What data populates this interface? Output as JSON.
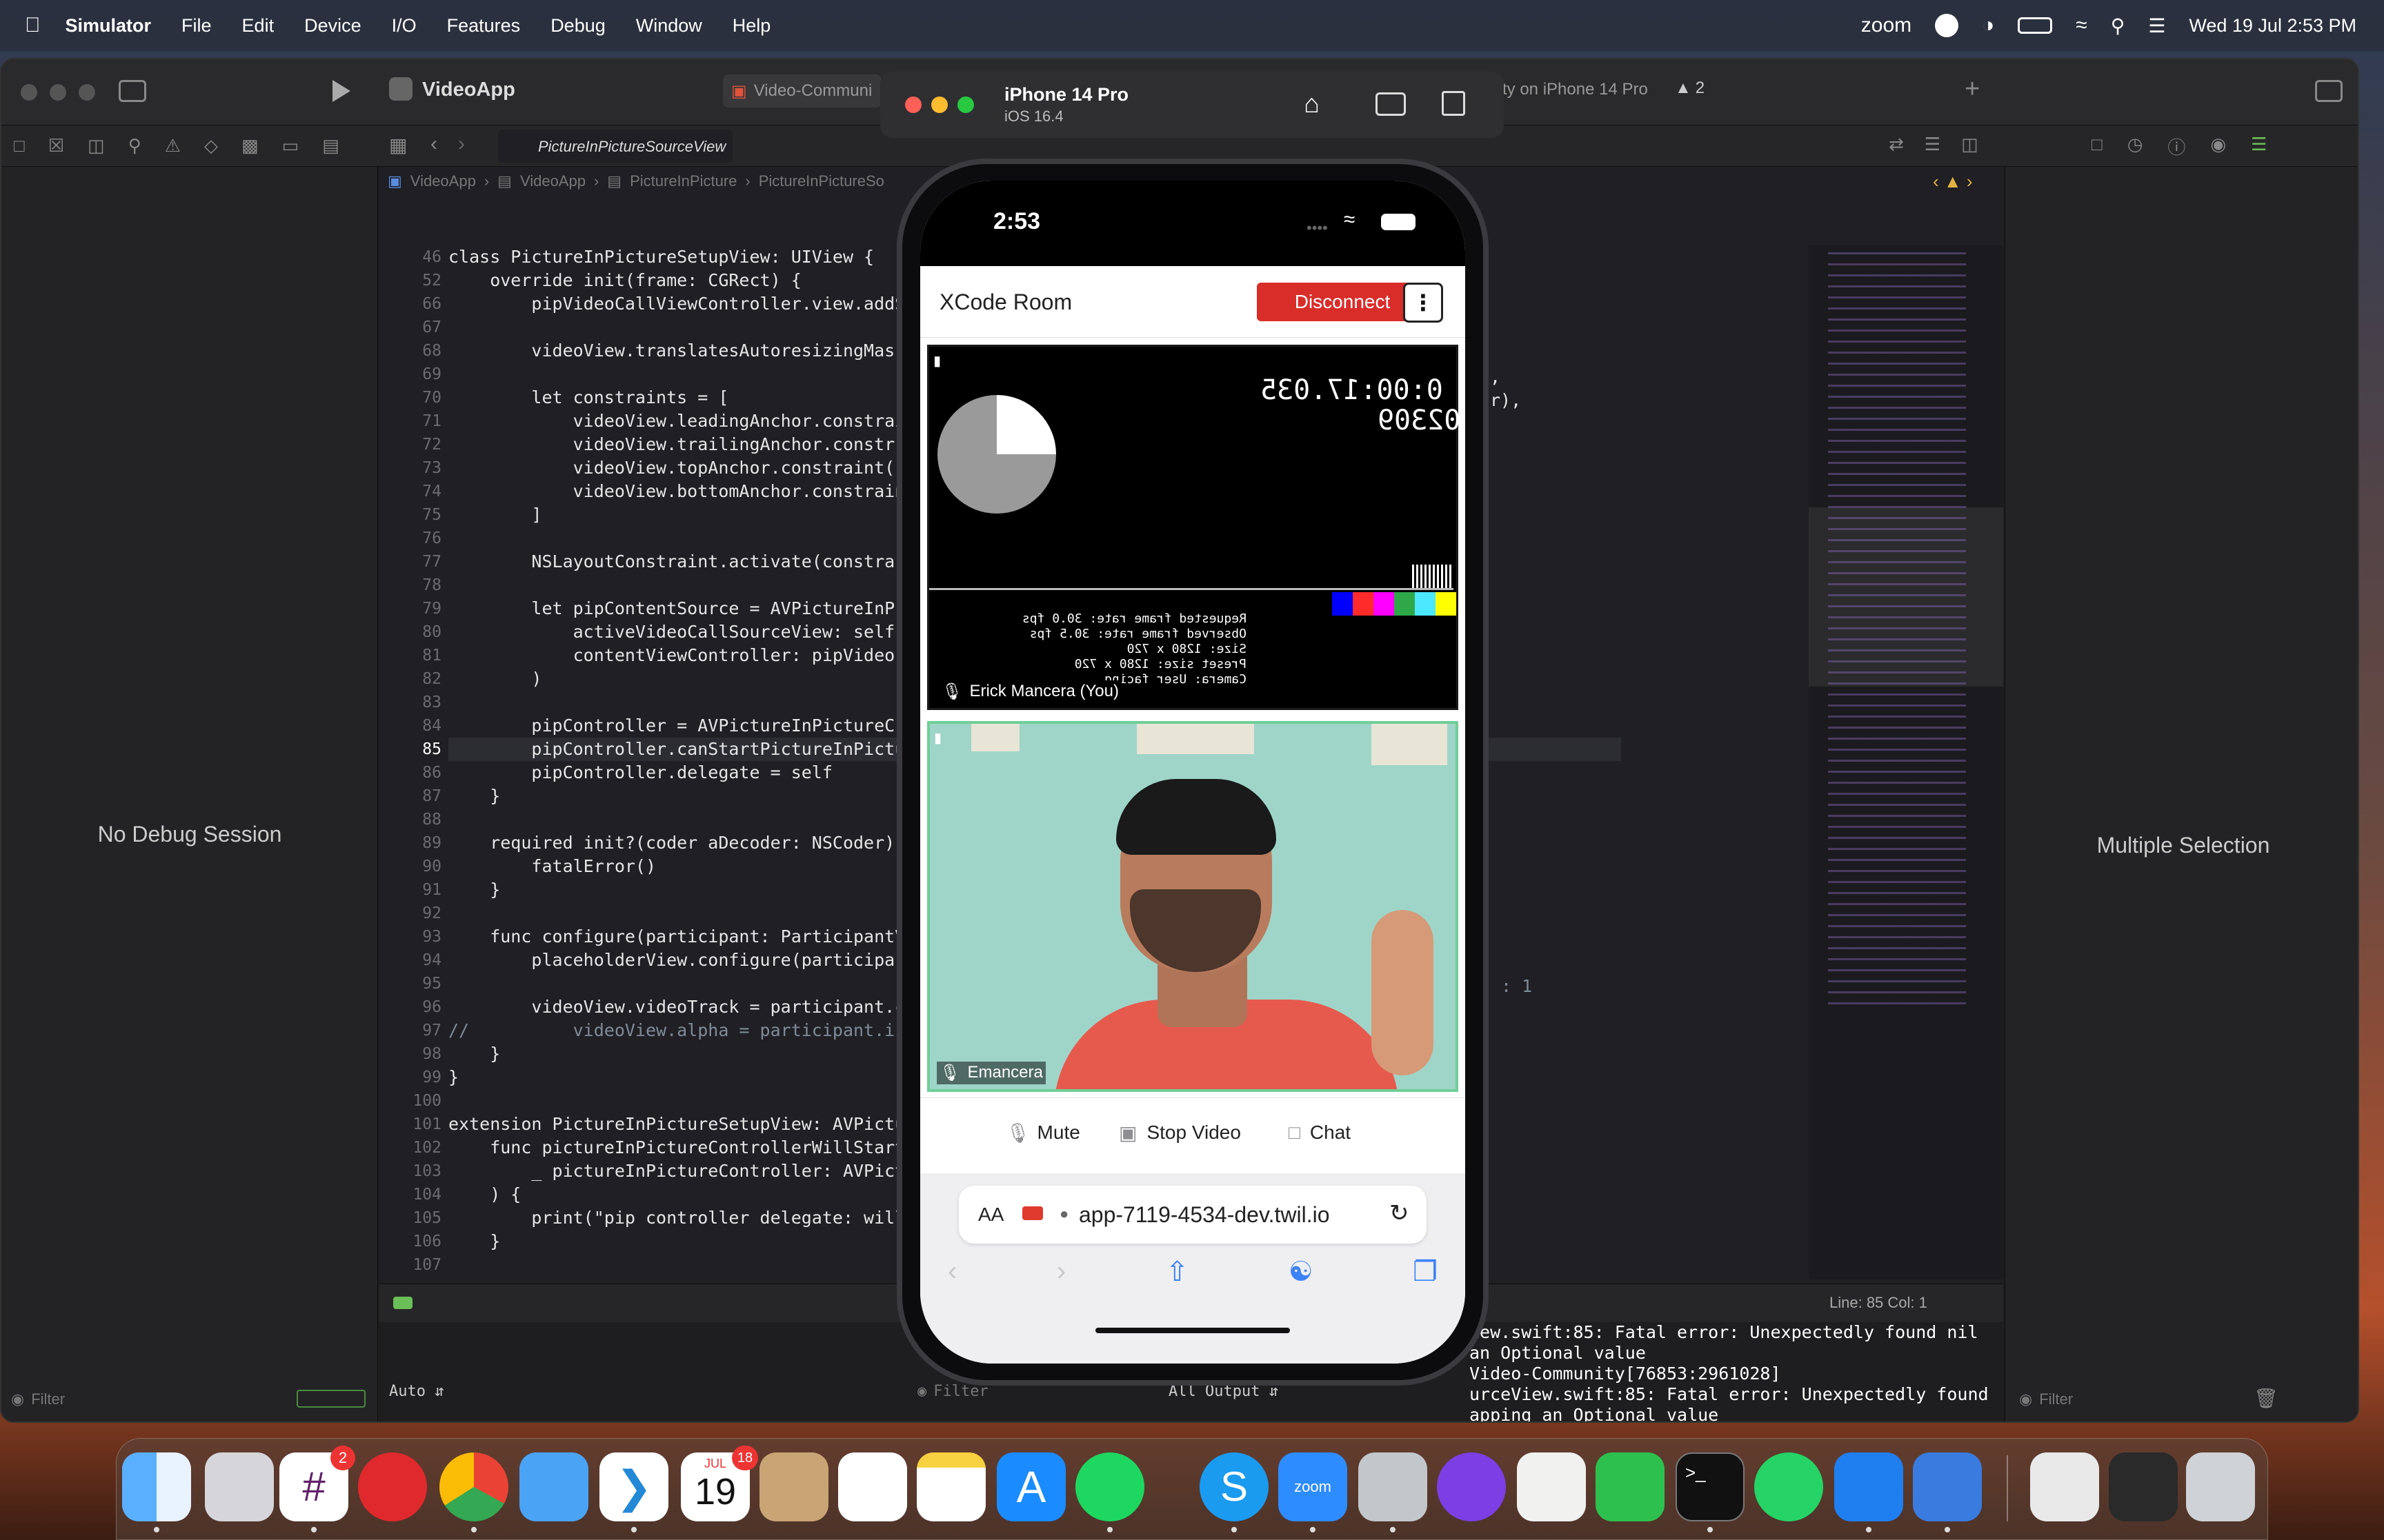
{
  "menubar": {
    "app_name": "Simulator",
    "menus": [
      "File",
      "Edit",
      "Device",
      "I/O",
      "Features",
      "Debug",
      "Window",
      "Help"
    ],
    "zoom_label": "zoom",
    "datetime": "Wed 19 Jul  2:53 PM"
  },
  "xcode": {
    "project": "VideoApp",
    "tab_active": "PictureInPictureSourceView",
    "tab_other": "Video-Communi",
    "scheme_destination": "ty on iPhone 14 Pro",
    "warning_count": "2",
    "breadcrumb": [
      "VideoApp",
      "VideoApp",
      "PictureInPicture",
      "PictureInPictureSo"
    ],
    "left_pane_status": "No Debug Session",
    "right_pane_status": "Multiple Selection",
    "cursor_position": "Line: 85  Col: 1",
    "filter_placeholder": "Filter",
    "debug_mode": "Auto",
    "output_select": "All Output",
    "console_lines": [
      "iew.swift:85: Fatal error: Unexpectedly found nil",
      "an Optional value",
      "Video-Community[76853:2961028]",
      "urceView.swift:85: Fatal error: Unexpectedly found",
      "apping an Optional value"
    ],
    "code_right_fragments": [
      ",",
      "r),",
      ": 1"
    ],
    "code": [
      {
        "n": "46",
        "t": "class PictureInPictureSetupView: UIView {"
      },
      {
        "n": "52",
        "t": "    override init(frame: CGRect) {"
      },
      {
        "n": "66",
        "t": "        pipVideoCallViewController.view.addS"
      },
      {
        "n": "67",
        "t": ""
      },
      {
        "n": "68",
        "t": "        videoView.translatesAutoresizingMask"
      },
      {
        "n": "69",
        "t": ""
      },
      {
        "n": "70",
        "t": "        let constraints = ["
      },
      {
        "n": "71",
        "t": "            videoView.leadingAnchor.constrai"
      },
      {
        "n": "72",
        "t": "            videoView.trailingAnchor.constr"
      },
      {
        "n": "73",
        "t": "            videoView.topAnchor.constraint("
      },
      {
        "n": "74",
        "t": "            videoView.bottomAnchor.constrain"
      },
      {
        "n": "75",
        "t": "        ]"
      },
      {
        "n": "76",
        "t": ""
      },
      {
        "n": "77",
        "t": "        NSLayoutConstraint.activate(constra"
      },
      {
        "n": "78",
        "t": ""
      },
      {
        "n": "79",
        "t": "        let pipContentSource = AVPictureInP"
      },
      {
        "n": "80",
        "t": "            activeVideoCallSourceView: self,"
      },
      {
        "n": "81",
        "t": "            contentViewController: pipVideo"
      },
      {
        "n": "82",
        "t": "        )"
      },
      {
        "n": "83",
        "t": ""
      },
      {
        "n": "84",
        "t": "        pipController = AVPictureInPictureC"
      },
      {
        "n": "85",
        "t": "        pipController.canStartPictureInPictu"
      },
      {
        "n": "86",
        "t": "        pipController.delegate = self"
      },
      {
        "n": "87",
        "t": "    }"
      },
      {
        "n": "88",
        "t": ""
      },
      {
        "n": "89",
        "t": "    required init?(coder aDecoder: NSCoder)"
      },
      {
        "n": "90",
        "t": "        fatalError()"
      },
      {
        "n": "91",
        "t": "    }"
      },
      {
        "n": "92",
        "t": ""
      },
      {
        "n": "93",
        "t": "    func configure(participant: ParticipantV"
      },
      {
        "n": "94",
        "t": "        placeholderView.configure(participa"
      },
      {
        "n": "95",
        "t": ""
      },
      {
        "n": "96",
        "t": "        videoView.videoTrack = participant.c"
      },
      {
        "n": "97",
        "t": "//          videoView.alpha = participant.isCa"
      },
      {
        "n": "98",
        "t": "    }"
      },
      {
        "n": "99",
        "t": "}"
      },
      {
        "n": "100",
        "t": ""
      },
      {
        "n": "101",
        "t": "extension PictureInPictureSetupView: AVPictu"
      },
      {
        "n": "102",
        "t": "    func pictureInPictureControllerWillStart"
      },
      {
        "n": "103",
        "t": "        _ pictureInPictureController: AVPict"
      },
      {
        "n": "104",
        "t": "    ) {"
      },
      {
        "n": "105",
        "t": "        print(\"pip controller delegate: will"
      },
      {
        "n": "106",
        "t": "    }"
      },
      {
        "n": "107",
        "t": ""
      }
    ]
  },
  "simulator": {
    "device_name": "iPhone 14 Pro",
    "os_version": "iOS 16.4"
  },
  "phone": {
    "time": "2:53",
    "room_title": "XCode Room",
    "disconnect_label": "Disconnect",
    "local_participant": "Erick Mancera (You)",
    "remote_participant": "Emancera",
    "mirrored_timecode": "0:00:17.035",
    "mirrored_frame": "02309",
    "mirrored_stats": [
      "Requested frame rate: 30.0 fps",
      "Observed frame rate: 30.5 fps",
      "Size: 1280 x 720",
      "Preset size: 1280 x 720",
      "Camera: User facing"
    ],
    "mute_label": "Mute",
    "stop_video_label": "Stop Video",
    "chat_label": "Chat",
    "aa_label": "AA",
    "url": "app-7119-4534-dev.twil.io"
  },
  "dock": {
    "slack_badge": "2",
    "calendar_month": "JUL",
    "calendar_day": "19",
    "calendar_badge": "18",
    "zoom_label": "zoom"
  },
  "colors": {
    "accent_red": "#d92d2a",
    "tile_border": "#6fcf97"
  }
}
